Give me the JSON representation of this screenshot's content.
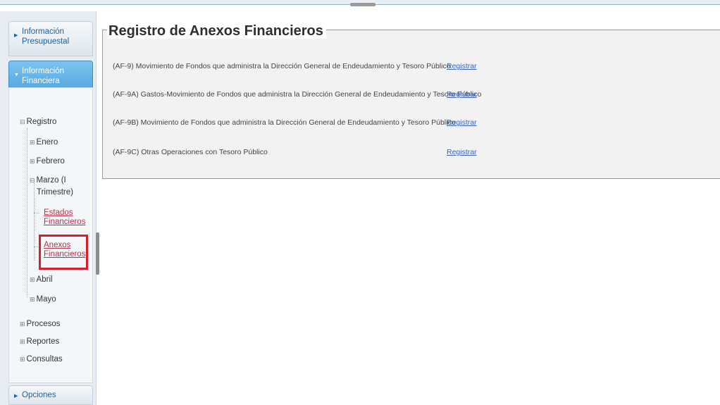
{
  "sidebar": {
    "sections": [
      {
        "label": "Información Presupuestal",
        "line1": "Información",
        "line2": "Presupuestal"
      },
      {
        "label": "Información Financiera",
        "line1": "Información",
        "line2": "Financiera"
      }
    ],
    "tree": {
      "registro": "Registro",
      "months": [
        "Enero",
        "Febrero",
        "Marzo (I",
        "Trimestre)",
        "Abril",
        "Mayo"
      ],
      "leaves": {
        "estados_1": "Estados",
        "estados_2": "Financieros",
        "anexos_1": "Anexos",
        "anexos_2": "Financieros"
      },
      "roots": [
        "Procesos",
        "Reportes",
        "Consultas"
      ]
    },
    "options_label": "Opciones"
  },
  "main": {
    "title": "Registro de Anexos Financieros",
    "rows": [
      {
        "text": "(AF-9) Movimiento de Fondos que administra la Dirección General de Endeudamiento y Tesoro Público",
        "link": "Registrar"
      },
      {
        "text": "(AF-9A) Gastos-Movimiento de Fondos que administra la Dirección General de Endeudamiento y Tesoro Público",
        "link": "Registrar"
      },
      {
        "text": "(AF-9B) Movimiento de Fondos que administra la Dirección General de Endeudamiento y Tesoro Público",
        "link": "Registrar"
      },
      {
        "text": "(AF-9C) Otras Operaciones con Tesoro Público",
        "link": "Registrar"
      }
    ]
  },
  "colors": {
    "accent": "#4aa3dd",
    "link": "#3a63b8",
    "selection": "#2f5fa8",
    "highlight_border": "#d9202a"
  },
  "icons": {
    "collapsed_arrow": "chevron-right-icon",
    "expanded_arrow": "chevron-down-icon",
    "expand_node": "plus-icon",
    "collapse_node": "minus-icon"
  }
}
